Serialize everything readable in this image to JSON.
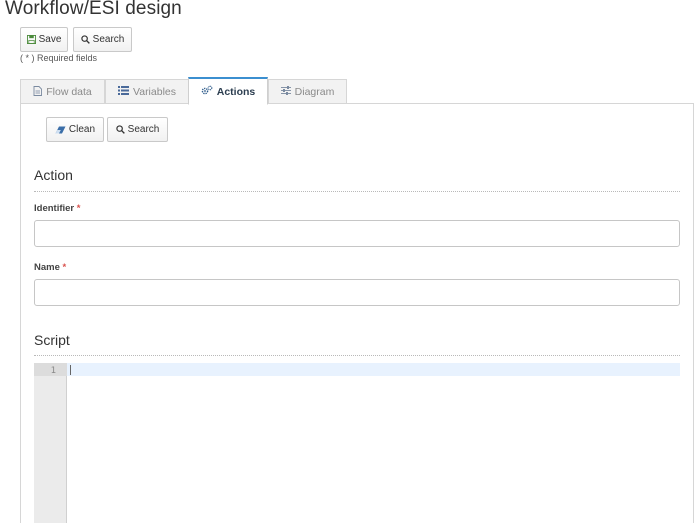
{
  "page": {
    "title": "Workflow/ESI design"
  },
  "toolbar": {
    "save_label": "Save",
    "search_label": "Search"
  },
  "required_note": "( * ) Required fields",
  "tabs": [
    {
      "label": "Flow data",
      "icon": "document-icon",
      "active": false
    },
    {
      "label": "Variables",
      "icon": "list-icon",
      "active": false
    },
    {
      "label": "Actions",
      "icon": "gears-icon",
      "active": true
    },
    {
      "label": "Diagram",
      "icon": "sliders-icon",
      "active": false
    }
  ],
  "panel_toolbar": {
    "clean_label": "Clean",
    "search_label": "Search"
  },
  "action_section": {
    "title": "Action",
    "identifier_label": "Identifier",
    "identifier_value": "",
    "name_label": "Name",
    "name_value": "",
    "required_marker": "*"
  },
  "script_section": {
    "title": "Script",
    "line_number": "1"
  },
  "colors": {
    "accent": "#3b8fd0",
    "required": "#d9534f",
    "active_line": "#e8f2fe"
  }
}
